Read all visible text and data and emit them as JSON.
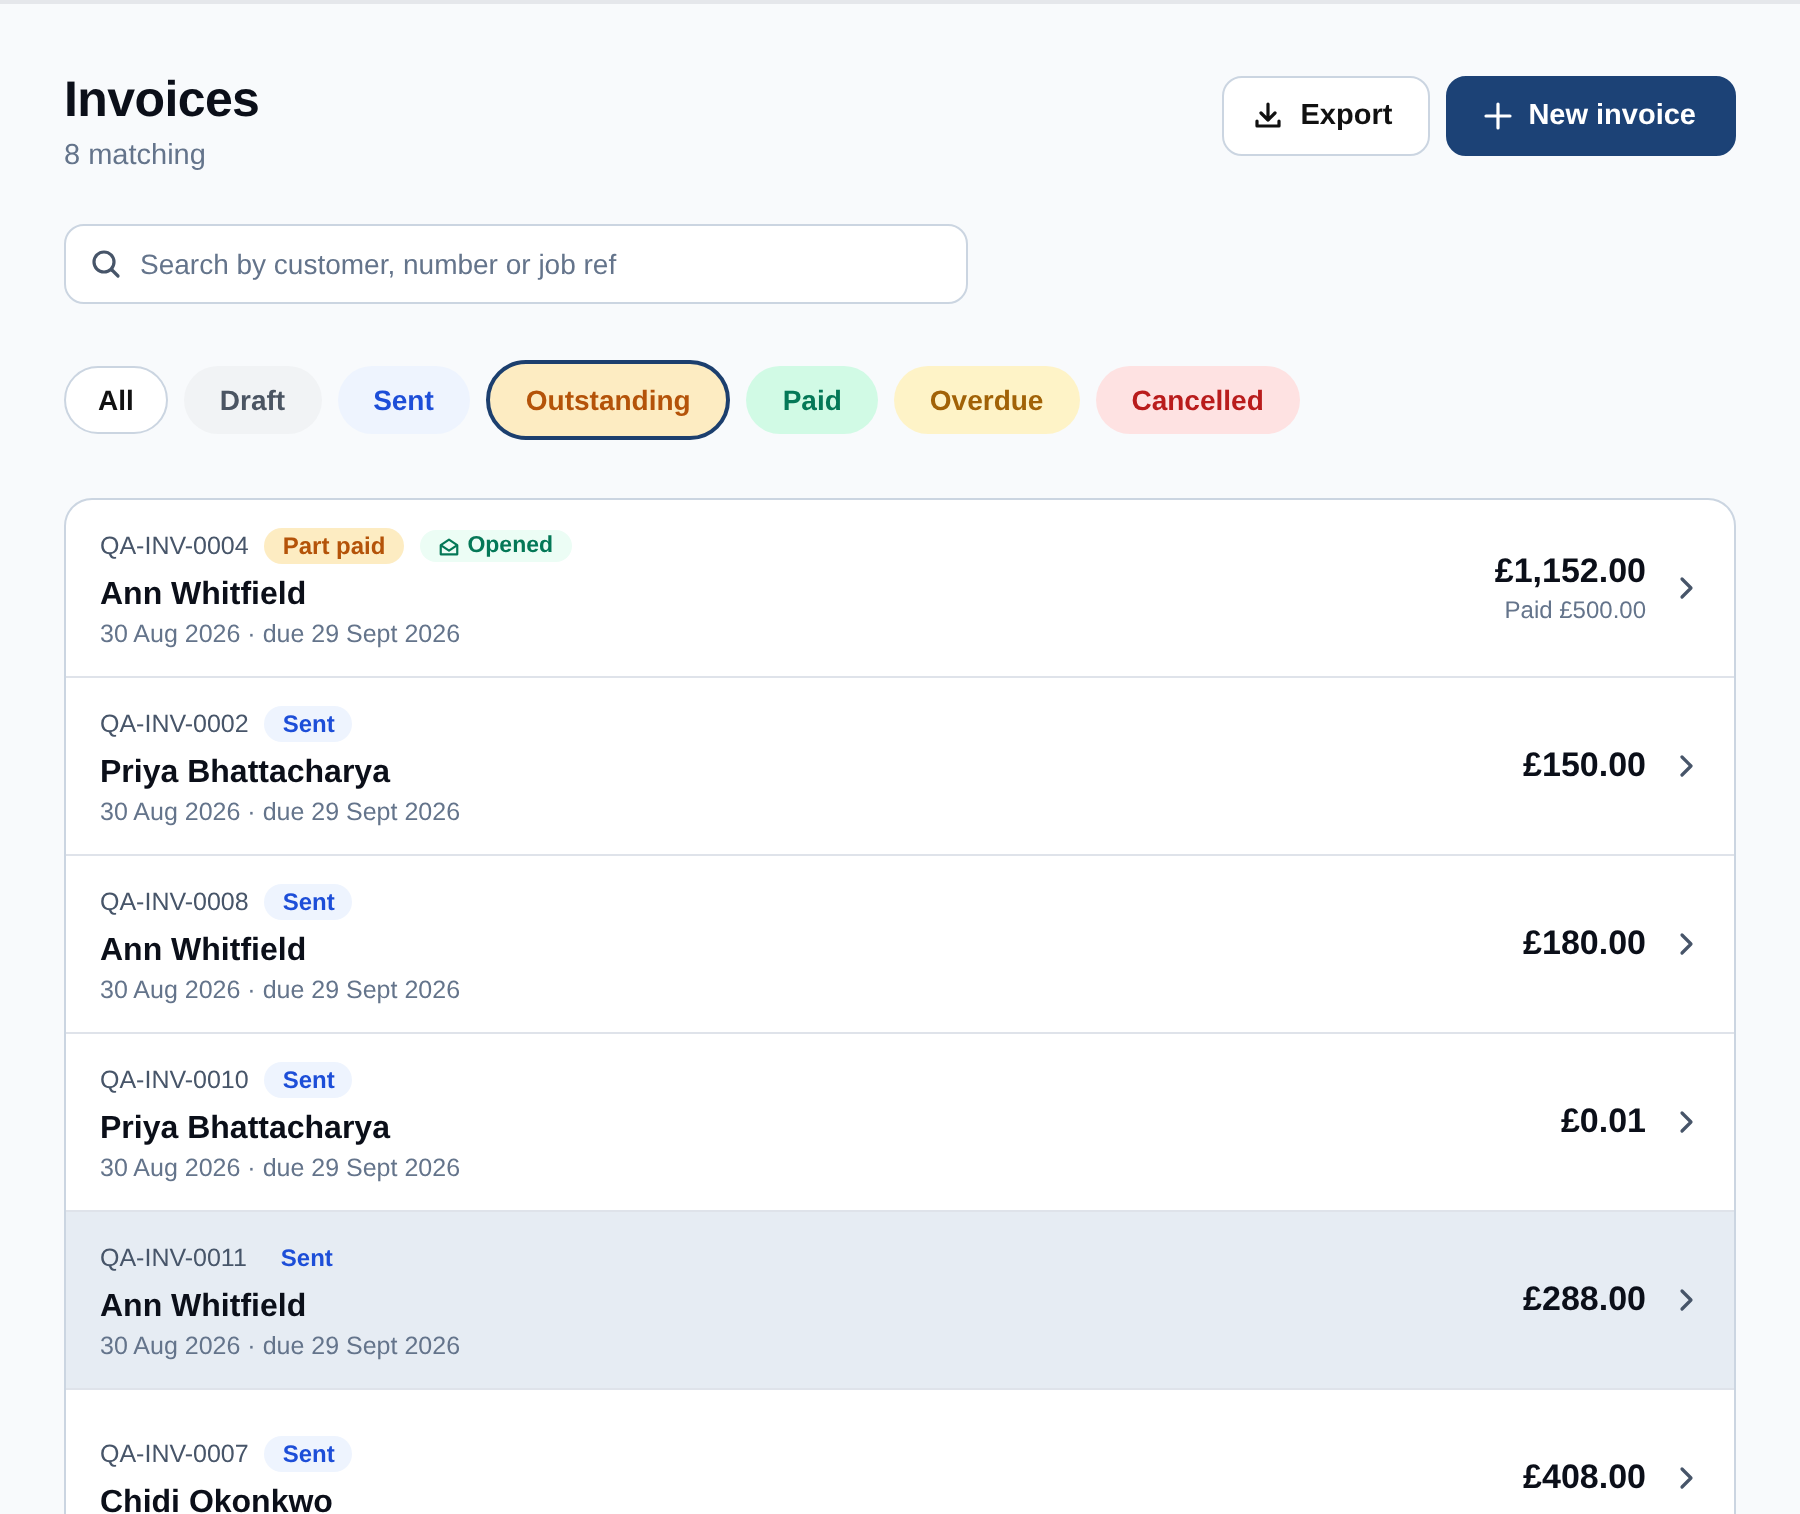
{
  "header": {
    "title": "Invoices",
    "subtitle": "8 matching"
  },
  "actions": [
    {
      "kind": "export",
      "label": "Export"
    },
    {
      "kind": "new",
      "label": "New invoice"
    }
  ],
  "search": {
    "placeholder": "Search by customer, number or job ref"
  },
  "filters": [
    {
      "label": "All",
      "kind": "all",
      "selected": false
    },
    {
      "label": "Draft",
      "kind": "draft",
      "selected": false
    },
    {
      "label": "Sent",
      "kind": "sent",
      "selected": false
    },
    {
      "label": "Outstanding",
      "kind": "outstanding",
      "selected": true
    },
    {
      "label": "Paid",
      "kind": "paid",
      "selected": false
    },
    {
      "label": "Overdue",
      "kind": "overdue",
      "selected": false
    },
    {
      "label": "Cancelled",
      "kind": "cancelled",
      "selected": false
    }
  ],
  "invoices": [
    {
      "number": "QA-INV-0004",
      "badges": [
        {
          "kind": "part_paid",
          "label": "Part paid"
        },
        {
          "kind": "opened",
          "label": "Opened"
        }
      ],
      "customer": "Ann Whitfield",
      "dates": "30 Aug 2026 · due 29 Sept 2026",
      "amount": "£1,152.00",
      "paid": "Paid £500.00",
      "highlighted": false
    },
    {
      "number": "QA-INV-0002",
      "badges": [
        {
          "kind": "sent",
          "label": "Sent"
        }
      ],
      "customer": "Priya Bhattacharya",
      "dates": "30 Aug 2026 · due 29 Sept 2026",
      "amount": "£150.00",
      "highlighted": false
    },
    {
      "number": "QA-INV-0008",
      "badges": [
        {
          "kind": "sent",
          "label": "Sent"
        }
      ],
      "customer": "Ann Whitfield",
      "dates": "30 Aug 2026 · due 29 Sept 2026",
      "amount": "£180.00",
      "highlighted": false
    },
    {
      "number": "QA-INV-0010",
      "badges": [
        {
          "kind": "sent",
          "label": "Sent"
        }
      ],
      "customer": "Priya Bhattacharya",
      "dates": "30 Aug 2026 · due 29 Sept 2026",
      "amount": "£0.01",
      "highlighted": false
    },
    {
      "number": "QA-INV-0011",
      "badges": [
        {
          "kind": "sent",
          "label": "Sent"
        }
      ],
      "customer": "Ann Whitfield",
      "dates": "30 Aug 2026 · due 29 Sept 2026",
      "amount": "£288.00",
      "highlighted": true
    },
    {
      "number": "QA-INV-0007",
      "badges": [
        {
          "kind": "sent",
          "label": "Sent"
        }
      ],
      "customer": "Chidi Okonkwo",
      "amount": "£408.00",
      "highlighted": false
    }
  ]
}
